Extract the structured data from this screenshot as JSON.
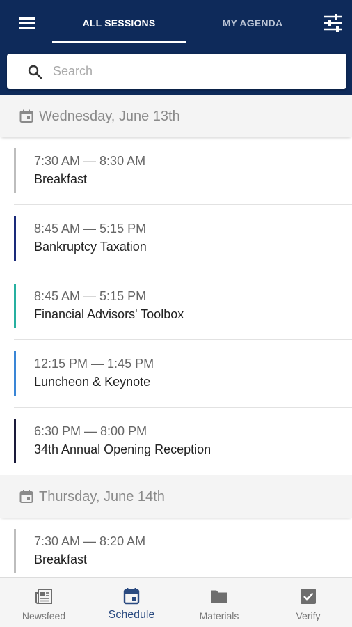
{
  "tabs": [
    {
      "label": "ALL SESSIONS",
      "active": true
    },
    {
      "label": "MY AGENDA",
      "active": false
    }
  ],
  "search": {
    "placeholder": "Search",
    "value": ""
  },
  "days": [
    {
      "title": "Wednesday, June 13th",
      "sessions": [
        {
          "time": "7:30 AM — 8:30 AM",
          "name": "Breakfast",
          "color": "#bdbdbd"
        },
        {
          "time": "8:45 AM — 5:15 PM",
          "name": "Bankruptcy Taxation",
          "color": "#1a2a7a"
        },
        {
          "time": "8:45 AM — 5:15 PM",
          "name": "Financial Advisors' Toolbox",
          "color": "#26b0a0"
        },
        {
          "time": "12:15 PM — 1:45 PM",
          "name": "Luncheon & Keynote",
          "color": "#3a86d6"
        },
        {
          "time": "6:30 PM — 8:00 PM",
          "name": "34th Annual Opening Reception",
          "color": "#1a1a3a"
        }
      ]
    },
    {
      "title": "Thursday, June 14th",
      "sessions": [
        {
          "time": "7:30 AM — 8:20 AM",
          "name": "Breakfast",
          "color": "#bdbdbd"
        }
      ]
    }
  ],
  "bottom_nav": [
    {
      "label": "Newsfeed",
      "icon": "newspaper-icon",
      "active": false
    },
    {
      "label": "Schedule",
      "icon": "calendar-icon",
      "active": true
    },
    {
      "label": "Materials",
      "icon": "folder-icon",
      "active": false
    },
    {
      "label": "Verify",
      "icon": "checkbox-icon",
      "active": false
    }
  ],
  "colors": {
    "header_bg": "#0e2a5a",
    "active_nav": "#2a4a80"
  }
}
